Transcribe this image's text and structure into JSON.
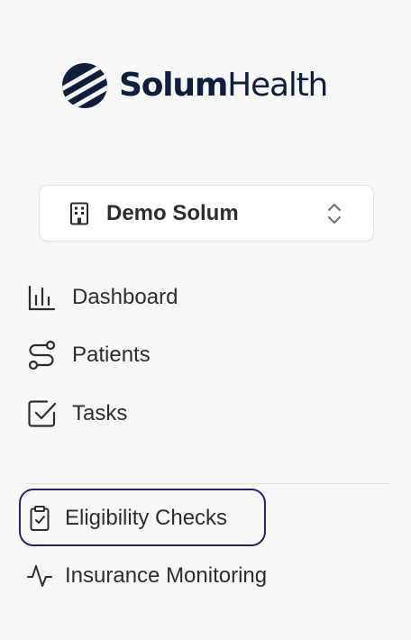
{
  "brand": {
    "logo_icon": "striped-globe-logo",
    "name_bold": "Solum",
    "name_light": "Health",
    "color": "#101e3d"
  },
  "org_selector": {
    "icon": "building-icon",
    "label": "Demo Solum",
    "toggle_icon": "chevrons-up-down-icon"
  },
  "nav": {
    "primary": [
      {
        "icon": "bar-chart-icon",
        "label": "Dashboard"
      },
      {
        "icon": "route-icon",
        "label": "Patients"
      },
      {
        "icon": "checkbox-icon",
        "label": "Tasks"
      }
    ],
    "secondary": [
      {
        "icon": "clipboard-check-icon",
        "label": "Eligibility Checks",
        "active": true
      },
      {
        "icon": "activity-icon",
        "label": "Insurance Monitoring",
        "active": false
      }
    ]
  },
  "colors": {
    "background": "#f8f8f8",
    "text": "#2b2d31",
    "active_outline": "#2a216d",
    "divider": "#e0e0e3"
  }
}
